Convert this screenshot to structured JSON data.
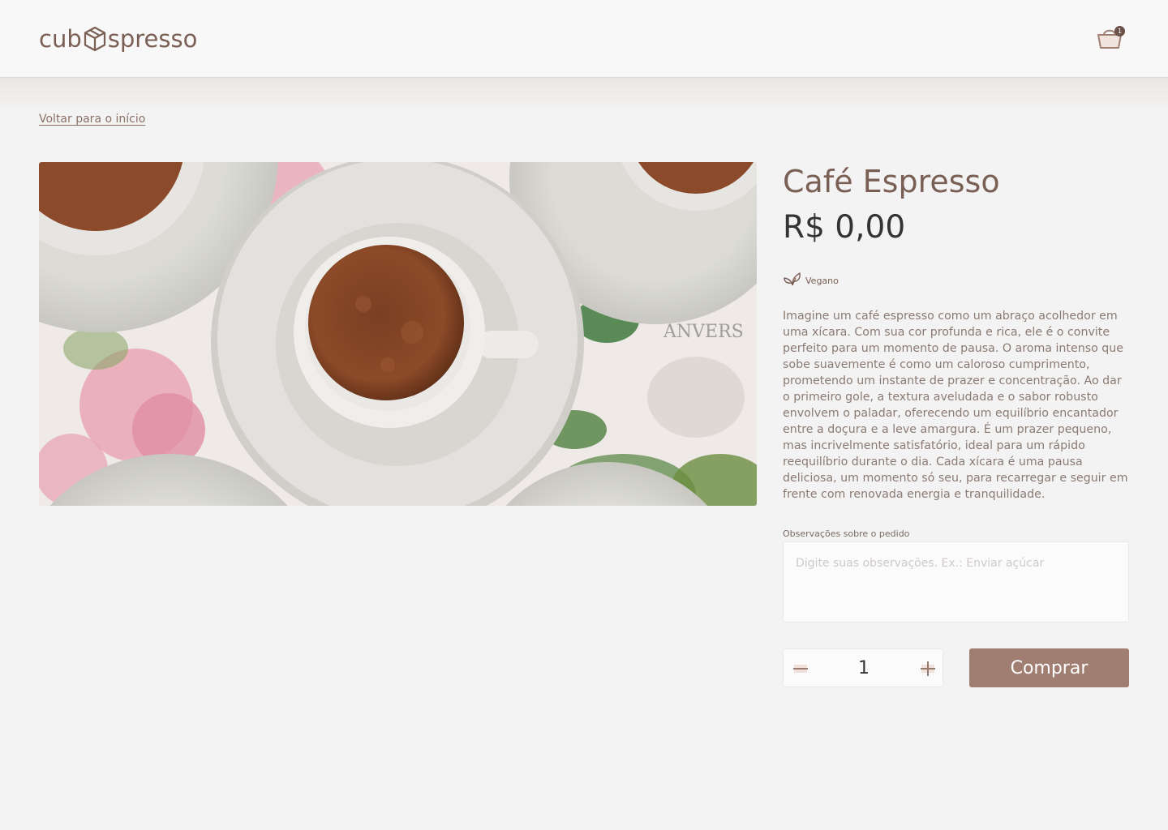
{
  "header": {
    "logo_left": "cub",
    "logo_right": "spresso",
    "cart_count": "1"
  },
  "nav": {
    "back_label": "Voltar para o início"
  },
  "product": {
    "title": "Café Espresso",
    "price": "R$ 0,00",
    "tag": "Vegano",
    "description": "Imagine um café espresso como um abraço acolhedor em uma xícara. Com sua cor profunda e rica, ele é o convite perfeito para um momento de pausa. O aroma intenso que sobe suavemente é como um caloroso cumprimento, prometendo um instante de prazer e concentração. Ao dar o primeiro gole, a textura aveludada e o sabor robusto envolvem o paladar, oferecendo um equilíbrio encantador entre a doçura e a leve amargura. É um prazer pequeno, mas incrivelmente satisfatório, ideal para um rápido reequilíbrio durante o dia. Cada xícara é uma pausa deliciosa, um momento só seu, para recarregar e seguir em frente com renovada energia e tranquilidade."
  },
  "order": {
    "notes_label": "Observações sobre o pedido",
    "notes_placeholder": "Digite suas observações. Ex.: Enviar açúcar",
    "notes_value": "",
    "quantity": "1",
    "buy_label": "Comprar"
  },
  "icons": {
    "logo_cube": "cube-icon",
    "cart": "shopping-basket-icon",
    "tag": "leaf-icon",
    "decrease": "minus-icon",
    "increase": "plus-icon"
  },
  "colors": {
    "brand": "#7a5f54",
    "button": "#a07f72",
    "background": "#f3f3f3"
  }
}
